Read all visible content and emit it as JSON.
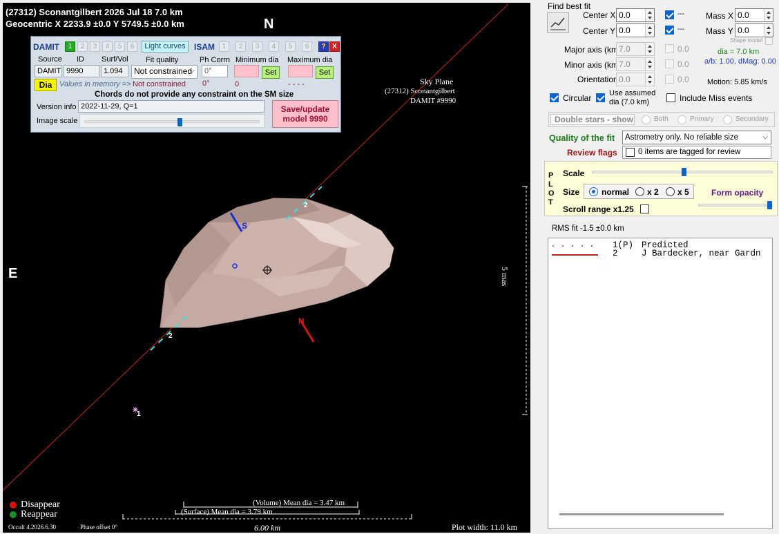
{
  "plot": {
    "title_line1": "(27312) Sconantgilbert  2026 Jul 18   7.0 km",
    "title_line2": "Geocentric  X  2233.9 ±0.0  Y 5749.5 ±0.0 km",
    "north": "N",
    "east": "E",
    "sky_plane": "Sky Plane",
    "sky_object": "(27312) Sconantgilbert",
    "sky_model": "DAMIT #9990",
    "scale_label": "5 mas",
    "pole_s": "S",
    "pole_n": "N",
    "chord_label_a": "2",
    "chord_label_b": "2",
    "predicted_label": "1",
    "legend_disappear": "Disappear",
    "legend_reappear": "Reappear",
    "version": "Occult 4.2026.6.30",
    "phase_offset": "Phase offset 0°",
    "volume_dia": "(Volume) Mean dia = 3.47 km",
    "surface_dia": "(Surface) Mean dia = 3.79 km",
    "scale_km": "6.00 km",
    "plot_width": "Plot width: 11.0 km",
    "colors": {
      "chord": "#cc1f1f",
      "disappear": "#e01010",
      "reappear": "#1e8c2a",
      "dashes": "#3de0e0",
      "shape": "#c9aea6",
      "spin_s": "#1a2fd8"
    }
  },
  "damit": {
    "title": "DAMIT",
    "tabs": [
      "1",
      "2",
      "3",
      "4",
      "5",
      "6"
    ],
    "light_curves": "Light curves",
    "isam": "ISAM",
    "isam_tabs": [
      "1",
      "2",
      "3",
      "4",
      "5",
      "6"
    ],
    "help": "?",
    "close": "X",
    "col_source": "Source",
    "col_id": "ID",
    "col_surf": "Surf/Vol",
    "col_fit": "Fit quality",
    "col_ph": "Ph Corrn",
    "col_min": "Minimum dia",
    "col_max": "Maximum dia",
    "source": "DAMIT",
    "id": "9990",
    "surf": "1.094",
    "fit_value": "Not constrained",
    "ph_value": "0°",
    "set1": "Set",
    "set2": "Set",
    "dia": "Dia",
    "memory": "Values in memory =>",
    "mem_fit": "Not constrained",
    "mem_ph": "0°",
    "mem_min": "0",
    "mem_max": "- - - -",
    "chords_note": "Chords do not provide any constraint on the SM size",
    "version_label": "Version info",
    "version_value": "2022-11-29, Q=1",
    "image_scale": "Image scale",
    "save": "Save/update model 9990"
  },
  "right": {
    "find_best": "Find best fit",
    "center_x": "Center X",
    "center_x_val": "0.0",
    "center_y": "Center Y",
    "center_y_val": "0.0",
    "dash1": "---",
    "dash2": "---",
    "mass_x": "Mass X",
    "mass_x_val": "0.0",
    "mass_y": "Mass Y",
    "mass_y_val": "0.0",
    "shape_model": "Shape model",
    "major": "Major axis (km)",
    "major_val": "7.0",
    "major_chk": "0.0",
    "minor": "Minor axis (km)",
    "minor_val": "7.0",
    "minor_chk": "0.0",
    "orient": "Orientation",
    "orient_val": "0.0",
    "orient_chk": "0.0",
    "dia_eq": "dia = 7.0 km",
    "ab": "a/b: 1.00, dMag: 0.00",
    "motion": "Motion: 5.85 km/s",
    "circular": "Circular",
    "use_assumed": "Use assumed",
    "use_assumed2": "dia (7.0 km)",
    "include_miss": "Include Miss events",
    "double_stars": "Double stars - show",
    "both": "Both",
    "primary": "Primary",
    "secondary": "Secondary",
    "quality": "Quality of the fit",
    "quality_val": "Astrometry only. No reliable size",
    "review": "Review flags",
    "review_val": "0 items are tagged for review",
    "plot_letters": [
      "P",
      "L",
      "O",
      "T"
    ],
    "scale": "Scale",
    "size": "Size",
    "normal": "normal",
    "x2": "x 2",
    "x5": "x 5",
    "form_opacity": "Form opacity",
    "scroll_range": "Scroll range x1.25",
    "rms": "RMS fit  -1.5 ±0.0 km",
    "list": [
      {
        "num": "1(P)",
        "name": "Predicted"
      },
      {
        "num": "2",
        "name": "J Bardecker, near Gardn"
      }
    ]
  }
}
